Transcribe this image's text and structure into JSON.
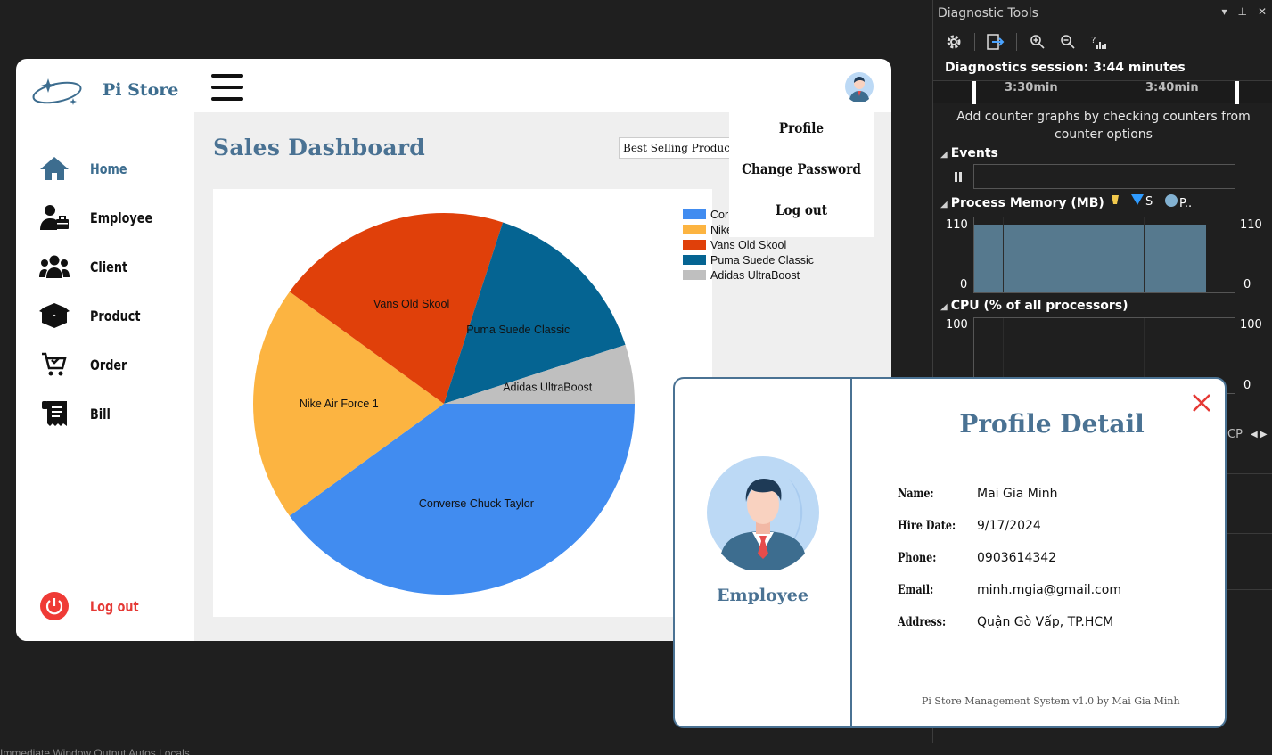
{
  "app": {
    "store_name": "Pi Store",
    "nav": [
      {
        "label": "Home",
        "icon": "home-icon"
      },
      {
        "label": "Employee",
        "icon": "employee-icon"
      },
      {
        "label": "Client",
        "icon": "client-icon"
      },
      {
        "label": "Product",
        "icon": "product-icon"
      },
      {
        "label": "Order",
        "icon": "order-icon"
      },
      {
        "label": "Bill",
        "icon": "bill-icon"
      }
    ],
    "logout_label": "Log out",
    "colors": {
      "accent": "#4a7293",
      "danger": "#e53935"
    }
  },
  "dashboard": {
    "title": "Sales Dashboard",
    "select_value": "Best Selling Products"
  },
  "profile_menu": {
    "items": [
      "Profile",
      "Change Password",
      "Log out"
    ]
  },
  "chart_data": {
    "type": "pie",
    "categories": [
      "Converse Chuck Taylor",
      "Nike Air Force 1",
      "Vans Old Skool",
      "Puma Suede Classic",
      "Adidas UltraBoost"
    ],
    "legend_labels": [
      "Cor",
      "Nike",
      "Vans Old Skool",
      "Puma Suede Classic",
      "Adidas UltraBoost"
    ],
    "values": [
      40,
      20,
      20,
      15,
      5
    ],
    "colors": [
      "#418cf0",
      "#fcb441",
      "#e0400a",
      "#056492",
      "#bfbfbf"
    ],
    "legend_position": "top-right"
  },
  "profile_dialog": {
    "title": "Profile Detail",
    "role": "Employee",
    "fields": [
      {
        "key": "Name:",
        "value": "Mai Gia Minh"
      },
      {
        "key": "Hire Date:",
        "value": "9/17/2024"
      },
      {
        "key": "Phone:",
        "value": "0903614342"
      },
      {
        "key": "Email:",
        "value": "minh.mgia@gmail.com"
      },
      {
        "key": "Address:",
        "value": "Quận Gò Vấp, TP.HCM"
      }
    ],
    "footer": "Pi Store Management System v1.0 by Mai Gia Minh"
  },
  "diagnostics": {
    "title": "Diagnostic Tools",
    "session": "Diagnostics session: 3:44 minutes",
    "ticks": [
      "3:30min",
      "3:40min"
    ],
    "hint": "Add counter graphs by checking counters from counter options",
    "events_label": "Events",
    "memory_label": "Process Memory (MB)",
    "memory_legend": [
      "S",
      "P.."
    ],
    "memory_max": "110",
    "memory_min": "0",
    "cpu_label": "CPU (% of all processors)",
    "cpu_max": "100",
    "cpu_min": "0",
    "cp_tab": "CP"
  },
  "bottom_strip": "Immediate Window   Output   Autos   Locals"
}
